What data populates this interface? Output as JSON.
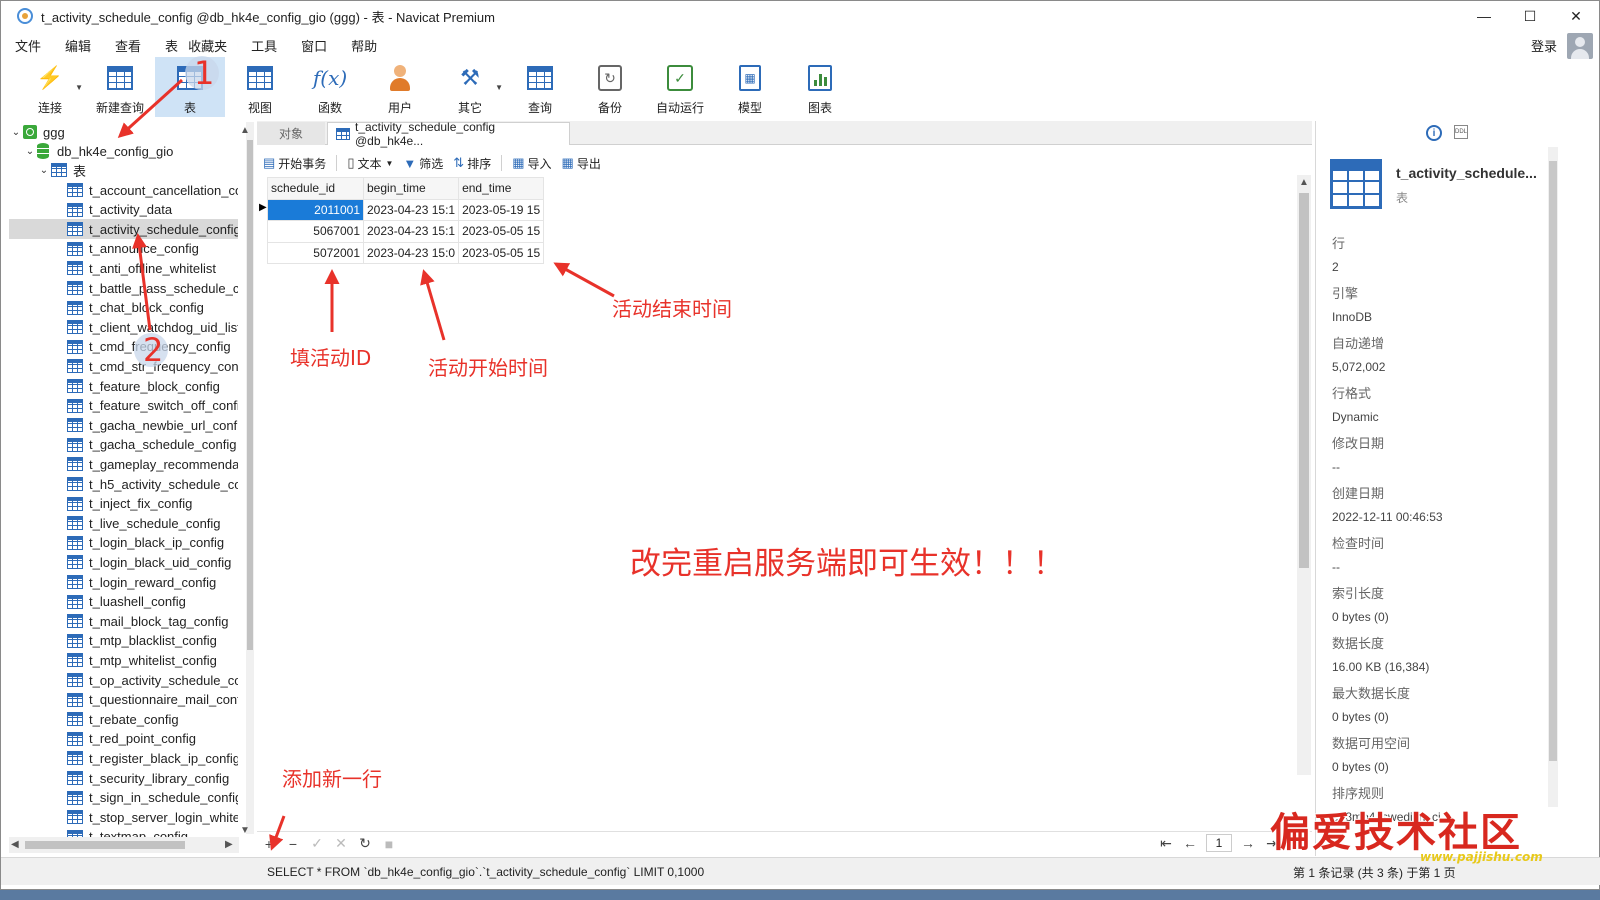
{
  "window": {
    "title": "t_activity_schedule_config @db_hk4e_config_gio (ggg) - 表 - Navicat Premium",
    "controls": [
      "—",
      "☐",
      "✕"
    ]
  },
  "menu": {
    "items": [
      "文件",
      "编辑",
      "查看",
      "表",
      "收藏夹",
      "工具",
      "窗口",
      "帮助"
    ],
    "login": "登录"
  },
  "toolbar": {
    "items": [
      {
        "label": "连接",
        "icon": "plug-icon"
      },
      {
        "label": "新建查询",
        "icon": "new-query-icon"
      },
      {
        "label": "表",
        "icon": "table-icon"
      },
      {
        "label": "视图",
        "icon": "view-icon"
      },
      {
        "label": "函数",
        "icon": "function-icon"
      },
      {
        "label": "用户",
        "icon": "user-icon"
      },
      {
        "label": "其它",
        "icon": "tools-icon"
      },
      {
        "label": "查询",
        "icon": "query-icon"
      },
      {
        "label": "备份",
        "icon": "backup-icon"
      },
      {
        "label": "自动运行",
        "icon": "schedule-icon"
      },
      {
        "label": "模型",
        "icon": "model-icon"
      },
      {
        "label": "图表",
        "icon": "chart-icon"
      }
    ],
    "active": "表"
  },
  "tree": {
    "connection": "ggg",
    "database": "db_hk4e_config_gio",
    "tables_folder": "表",
    "tables": [
      "t_account_cancellation_cor",
      "t_activity_data",
      "t_activity_schedule_config",
      "t_announce_config",
      "t_anti_offline_whitelist",
      "t_battle_pass_schedule_coi",
      "t_chat_block_config",
      "t_client_watchdog_uid_list_",
      "t_cmd_frequency_config",
      "t_cmd_str_frequency_confi",
      "t_feature_block_config",
      "t_feature_switch_off_config",
      "t_gacha_newbie_url_config",
      "t_gacha_schedule_config",
      "t_gameplay_recommendat",
      "t_h5_activity_schedule_cont",
      "t_inject_fix_config",
      "t_live_schedule_config",
      "t_login_black_ip_config",
      "t_login_black_uid_config",
      "t_login_reward_config",
      "t_luashell_config",
      "t_mail_block_tag_config",
      "t_mtp_blacklist_config",
      "t_mtp_whitelist_config",
      "t_op_activity_schedule_con",
      "t_questionnaire_mail_confi",
      "t_rebate_config",
      "t_red_point_config",
      "t_register_black_ip_config",
      "t_security_library_config",
      "t_sign_in_schedule_config",
      "t_stop_server_login_white_",
      "t_textmap_config"
    ],
    "selected_index": 2
  },
  "tabs": {
    "objects": "对象",
    "table_tab": "t_activity_schedule_config @db_hk4e..."
  },
  "subtoolbar": {
    "begin_tx": "开始事务",
    "text": "文本",
    "filter": "筛选",
    "sort": "排序",
    "import": "导入",
    "export": "导出"
  },
  "grid": {
    "columns": [
      "schedule_id",
      "begin_time",
      "end_time"
    ],
    "rows": [
      [
        "2011001",
        "2023-04-23 15:1",
        "2023-05-19 15"
      ],
      [
        "5067001",
        "2023-04-23 15:1",
        "2023-05-05 15"
      ],
      [
        "5072001",
        "2023-04-23 15:0",
        "2023-05-05 15"
      ]
    ],
    "selected_row": 0
  },
  "annotations": {
    "marker1": "1",
    "marker2": "2",
    "fill_id": "填活动ID",
    "start_time": "活动开始时间",
    "end_time": "活动结束时间",
    "restart": "改完重启服务端即可生效！！！",
    "add_row": "添加新一行"
  },
  "navbar": {
    "page": "1"
  },
  "status": {
    "sql": "SELECT * FROM `db_hk4e_config_gio`.`t_activity_schedule_config` LIMIT 0,1000",
    "records": "第 1 条记录 (共 3 条) 于第 1 页"
  },
  "info": {
    "name": "t_activity_schedule...",
    "type": "表",
    "fields": [
      {
        "label": "行",
        "value": "2"
      },
      {
        "label": "引擎",
        "value": "InnoDB"
      },
      {
        "label": "自动递增",
        "value": "5,072,002"
      },
      {
        "label": "行格式",
        "value": "Dynamic"
      },
      {
        "label": "修改日期",
        "value": "--"
      },
      {
        "label": "创建日期",
        "value": "2022-12-11 00:46:53"
      },
      {
        "label": "检查时间",
        "value": "--"
      },
      {
        "label": "索引长度",
        "value": "0 bytes (0)"
      },
      {
        "label": "数据长度",
        "value": "16.00 KB (16,384)"
      },
      {
        "label": "最大数据长度",
        "value": "0 bytes (0)"
      },
      {
        "label": "数据可用空间",
        "value": "0 bytes (0)"
      },
      {
        "label": "排序规则",
        "value": "utf8mb4_swedish_ci"
      }
    ]
  },
  "watermark": {
    "text": "偏爱技术社区",
    "url": "www.pajjishu.com"
  },
  "colors": {
    "annotation": "#e8322a",
    "selection": "#1a7bd8",
    "accent": "#2d6bb8"
  }
}
